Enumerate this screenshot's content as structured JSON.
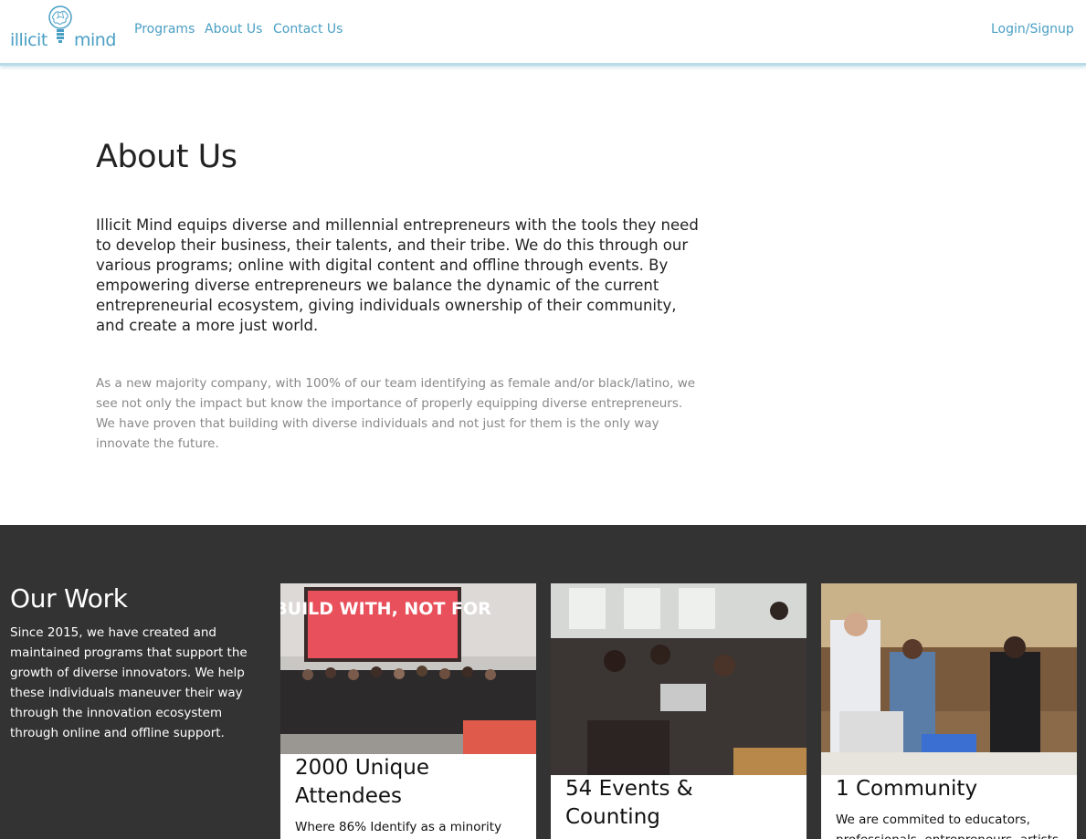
{
  "header": {
    "logo_left": "illicit",
    "logo_right": "mind",
    "nav": [
      "Programs",
      "About Us",
      "Contact Us"
    ],
    "login": "Login/Signup"
  },
  "about": {
    "title": "About Us",
    "lead": "Illicit Mind equips diverse and millennial entrepreneurs with the tools they need to develop their business, their talents, and their tribe. We do this through our various programs; online with digital content and offline through events. By empowering diverse entrepreneurs we balance the dynamic of the current entrepreneurial ecosystem, giving individuals ownership of their community, and create a more just world.",
    "sub": "As a new majority company, with 100% of our team identifying as female and/or black/latino, we see not only the impact but know the importance of properly equipping diverse entrepreneurs. We have proven that building with diverse individuals and not just for them is the only way innovate the future."
  },
  "work": {
    "title": "Our Work",
    "desc": "Since 2015, we have created and maintained programs that support the growth of diverse innovators. We help these individuals maneuver their way through the innovation ecosystem through online and offline support.",
    "cards": [
      {
        "title": "2000 Unique Attendees",
        "text": "Where 86% Identify as a minority",
        "photo_sign_text": "BUILD WITH, NOT FOR"
      },
      {
        "title": "54 Events & Counting",
        "text": ""
      },
      {
        "title": "1 Community",
        "text": "We are commited to educators, professionals, entrepreneurs, artists"
      }
    ]
  },
  "colors": {
    "brand_blue": "#4a9fc4",
    "dark_section": "#333333",
    "header_border": "#b9dbe8"
  }
}
